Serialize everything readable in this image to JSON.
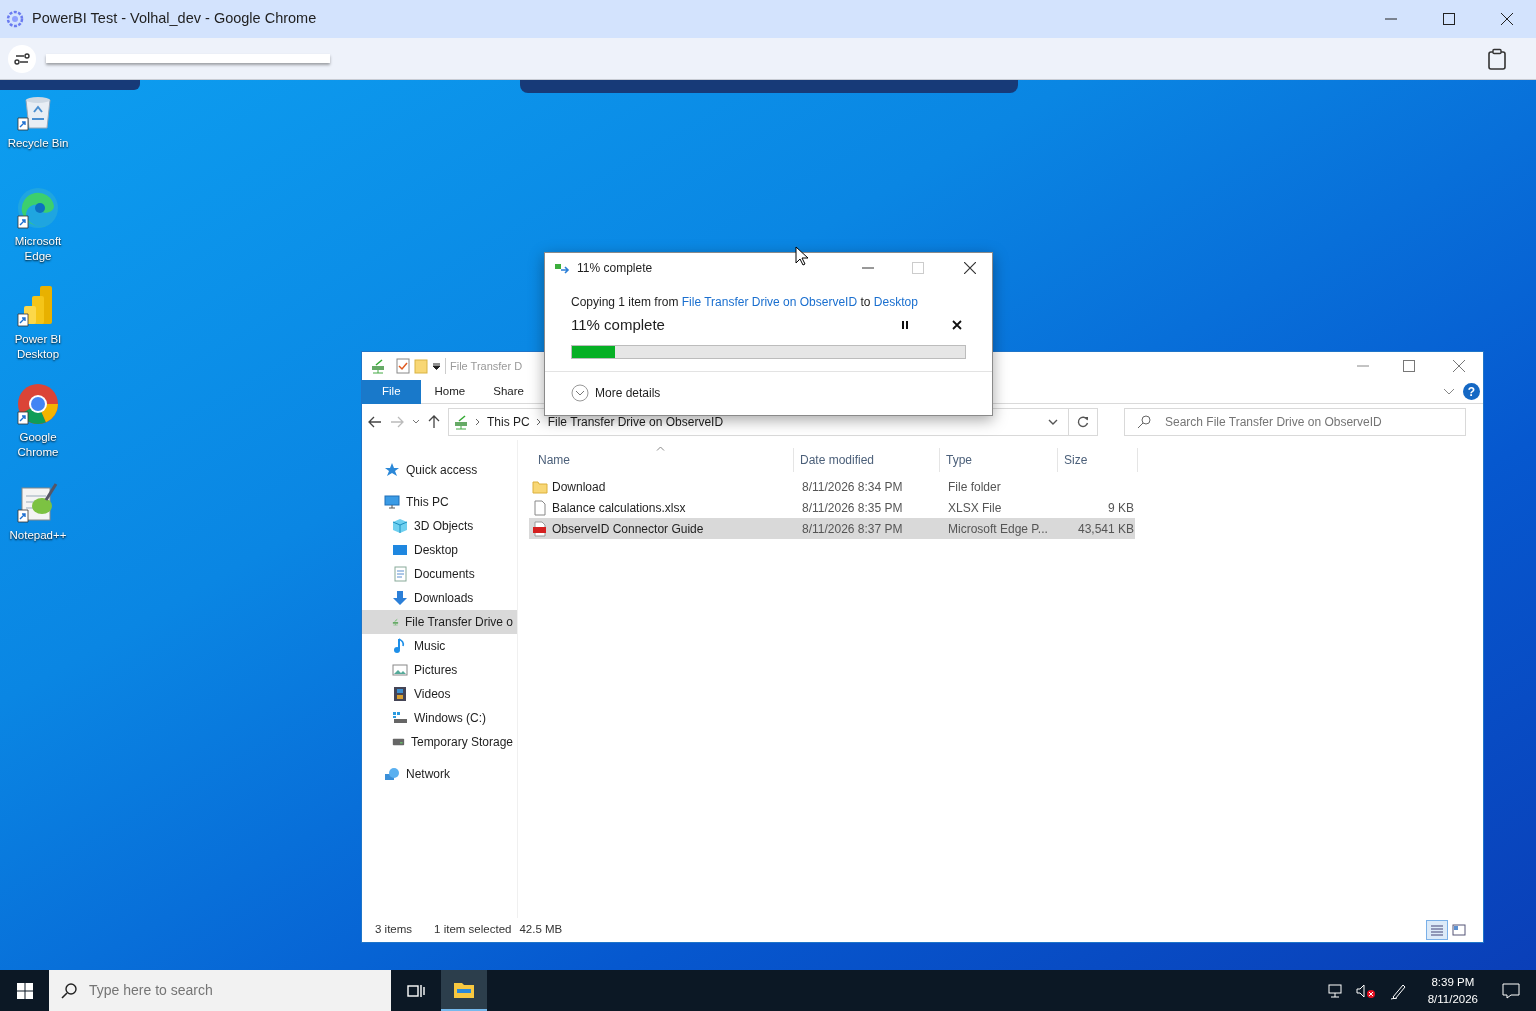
{
  "browser": {
    "title": "PowerBI Test - Volhal_dev - Google Chrome"
  },
  "desktop_icons": [
    {
      "label": "Recycle Bin",
      "kind": "recycle"
    },
    {
      "label": "Microsoft Edge",
      "kind": "edge"
    },
    {
      "label": "Power BI Desktop",
      "kind": "powerbi"
    },
    {
      "label": "Google Chrome",
      "kind": "chrome"
    },
    {
      "label": "Notepad++",
      "kind": "notepad"
    }
  ],
  "explorer": {
    "title": "File Transfer D",
    "ribbon_tabs": [
      {
        "label": "File",
        "selected": true
      },
      {
        "label": "Home",
        "selected": false
      },
      {
        "label": "Share",
        "selected": false
      }
    ],
    "help": "?",
    "breadcrumb": [
      "This PC",
      "File Transfer Drive on ObserveID"
    ],
    "search": {
      "placeholder": "Search File Transfer Drive on ObserveID"
    },
    "nav": [
      {
        "label": "Quick access",
        "kind": "star",
        "selected": false
      },
      {
        "label": "This PC",
        "kind": "pc",
        "selected": false,
        "children": [
          {
            "label": "3D Objects",
            "kind": "cube",
            "selected": false
          },
          {
            "label": "Desktop",
            "kind": "desktop",
            "selected": false
          },
          {
            "label": "Documents",
            "kind": "documents",
            "selected": false
          },
          {
            "label": "Downloads",
            "kind": "download",
            "selected": false
          },
          {
            "label": "File Transfer Drive o",
            "kind": "netdrive",
            "selected": true
          },
          {
            "label": "Music",
            "kind": "music",
            "selected": false
          },
          {
            "label": "Pictures",
            "kind": "pictures",
            "selected": false
          },
          {
            "label": "Videos",
            "kind": "videos",
            "selected": false
          },
          {
            "label": "Windows (C:)",
            "kind": "windrive",
            "selected": false
          },
          {
            "label": "Temporary Storage",
            "kind": "drive",
            "selected": false
          }
        ]
      },
      {
        "label": "Network",
        "kind": "network",
        "selected": false
      }
    ],
    "columns": [
      "Name",
      "Date modified",
      "Type",
      "Size"
    ],
    "rows": [
      {
        "name": "Download",
        "date": "8/11/2026 8:34 PM",
        "type": "File folder",
        "size": "",
        "kind": "folder",
        "selected": false
      },
      {
        "name": "Balance calculations.xlsx",
        "date": "8/11/2026 8:35 PM",
        "type": "XLSX File",
        "size": "9 KB",
        "kind": "file",
        "selected": false
      },
      {
        "name": "ObserveID Connector Guide",
        "date": "8/11/2026 8:37 PM",
        "type": "Microsoft Edge P...",
        "size": "43,541 KB",
        "kind": "pdf",
        "selected": true
      }
    ],
    "status": {
      "count": "3 items",
      "selection": "1 item selected",
      "size": "42.5 MB"
    },
    "views": [
      {
        "kind": "details",
        "selected": true
      },
      {
        "kind": "tiles",
        "selected": false
      }
    ]
  },
  "copy_dialog": {
    "title": "11% complete",
    "message": [
      {
        "text": "Copying 1 item from",
        "kind": "text"
      },
      {
        "text": "File Transfer Drive on ObserveID",
        "kind": "link"
      },
      {
        "text": "to",
        "kind": "text"
      },
      {
        "text": "Desktop",
        "kind": "link"
      }
    ],
    "progress_label": "11% complete",
    "level": 0.11,
    "more": "More details"
  },
  "taskbar": {
    "search_placeholder": "Type here to search",
    "time": "8:39 PM",
    "date": "8/11/2026"
  }
}
